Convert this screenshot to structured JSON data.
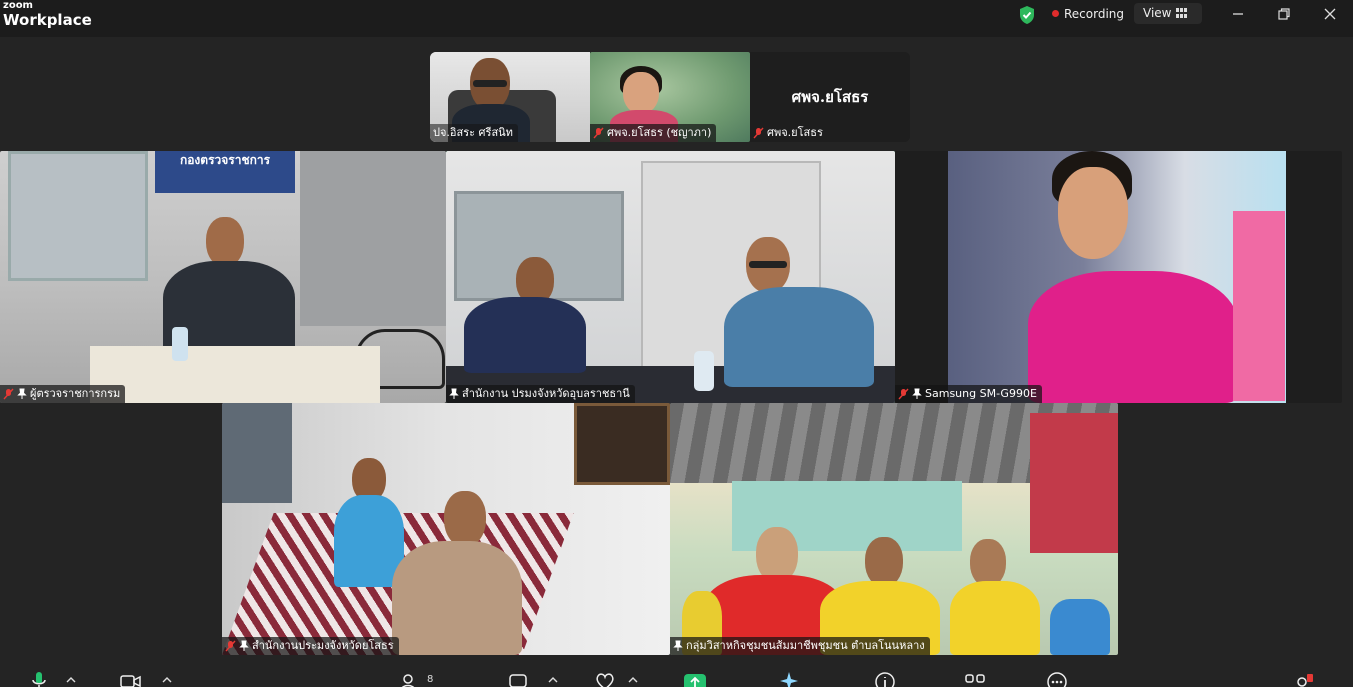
{
  "app": {
    "brand_top": "zoom",
    "brand_bottom": "Workplace"
  },
  "titlebar": {
    "recording_label": "Recording",
    "view_label": "View"
  },
  "top_strip": [
    {
      "name": "ปจ.อิสระ ศรีสนิท",
      "muted": false
    },
    {
      "name": "ศพจ.ยโสธร (ชญาภา)",
      "muted": true
    },
    {
      "name": "ศพจ.ยโสธร",
      "muted": true,
      "display_text": "ศพจ.ยโสธร"
    }
  ],
  "gallery": [
    {
      "name": "ผู้ตรวจราชการกรม",
      "muted": true,
      "pinned": true,
      "sign": "กองตรวจราชการ"
    },
    {
      "name": "สำนักงาน ปรมงจังหวัดอุบลราชธานี",
      "muted": false,
      "pinned": true,
      "active": true
    },
    {
      "name": "Samsung SM-G990E",
      "muted": true,
      "pinned": true
    },
    {
      "name": "สำนักงานประมงจังหวัดยโสธร",
      "muted": true,
      "pinned": true
    },
    {
      "name": "กลุ่มวิสาหกิจชุมชนส้มมาชีพชุมชน ตำบลโนนหลาง",
      "muted": false,
      "pinned": true
    }
  ],
  "toolbar": {
    "participants_count": "8"
  },
  "colors": {
    "accent_active": "#43c98a",
    "recording_dot": "#e02c2c",
    "shield": "#2eb85c",
    "muted": "#e53935"
  }
}
